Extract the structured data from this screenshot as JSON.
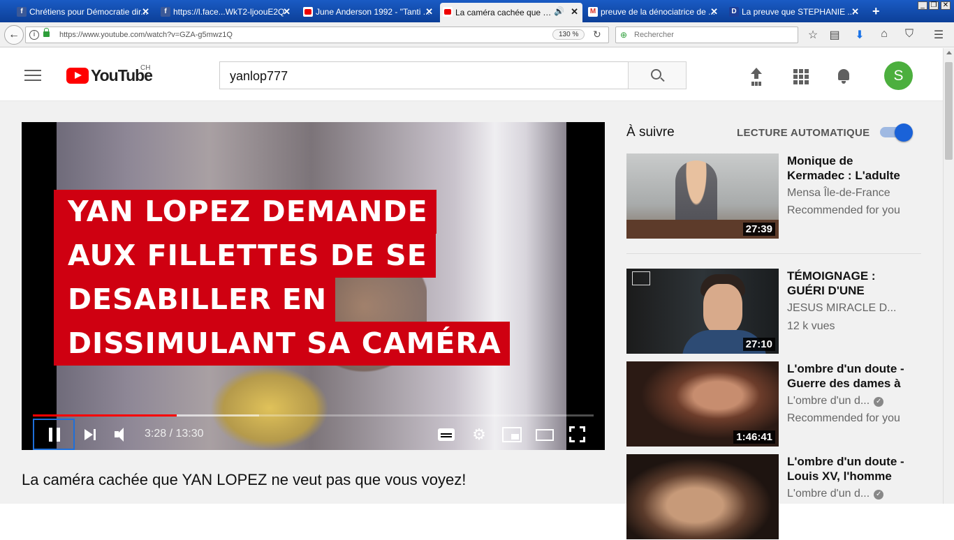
{
  "browser": {
    "tabs": [
      {
        "title": "Chrétiens pour Démocratie dir...",
        "favicon": "facebook-icon",
        "active": false
      },
      {
        "title": "https://l.face...WkT2-ljoouE2Q",
        "favicon": "facebook-icon",
        "active": false
      },
      {
        "title": "June Anderson 1992 - \"Tanti ...",
        "favicon": "youtube-icon",
        "active": false
      },
      {
        "title": "La caméra cachée que Y...",
        "favicon": "youtube-icon",
        "active": true
      },
      {
        "title": "preuve de la dénociatrice de ...",
        "favicon": "gmail-icon",
        "active": false
      },
      {
        "title": "La preuve que STEPHANIE ...",
        "favicon": "dailymotion-icon",
        "active": false
      }
    ],
    "url": "https://www.youtube.com/watch?v=GZA-g5mwz1Q",
    "zoom": "130 %",
    "search_placeholder": "Rechercher"
  },
  "youtube": {
    "logo_text": "YouTube",
    "country_code": "CH",
    "search_value": "yanlop777",
    "avatar_letter": "S"
  },
  "video": {
    "caption_lines": [
      "YAN LOPEZ DEMANDE",
      "AUX FILLETTES DE SE",
      "DESABILLER EN",
      "DISSIMULANT SA CAMÉRA"
    ],
    "current_time": "3:28",
    "duration": "13:30",
    "time_display": "3:28 / 13:30",
    "progress_played_fraction": 0.256,
    "progress_loaded_fraction": 0.404,
    "title": "La caméra cachée que YAN LOPEZ ne veut pas que vous voyez!"
  },
  "sidebar": {
    "up_next_label": "À suivre",
    "autoplay_label": "LECTURE AUTOMATIQUE",
    "autoplay_on": true,
    "recommendations": [
      {
        "title": "Monique de Kermadec : L'adulte",
        "channel": "Mensa Île-de-France",
        "meta": "Recommended for you",
        "duration": "27:39",
        "verified": false
      },
      {
        "title": "TÉMOIGNAGE : GUÉRI D'UNE",
        "channel": "JESUS MIRACLE D...",
        "meta": "12 k vues",
        "duration": "27:10",
        "verified": false
      },
      {
        "title": "L'ombre d'un doute - Guerre des dames à",
        "channel": "L'ombre d'un d...",
        "meta": "Recommended for you",
        "duration": "1:46:41",
        "verified": true
      },
      {
        "title": "L'ombre d'un doute - Louis XV, l'homme",
        "channel": "L'ombre d'un d...",
        "meta": "",
        "duration": "",
        "verified": true
      }
    ]
  },
  "colors": {
    "youtube_red": "#ff0000",
    "caption_red": "#cf0011",
    "autoplay_blue": "#1a62d8",
    "tabbar_blue": "#0c3f98"
  }
}
